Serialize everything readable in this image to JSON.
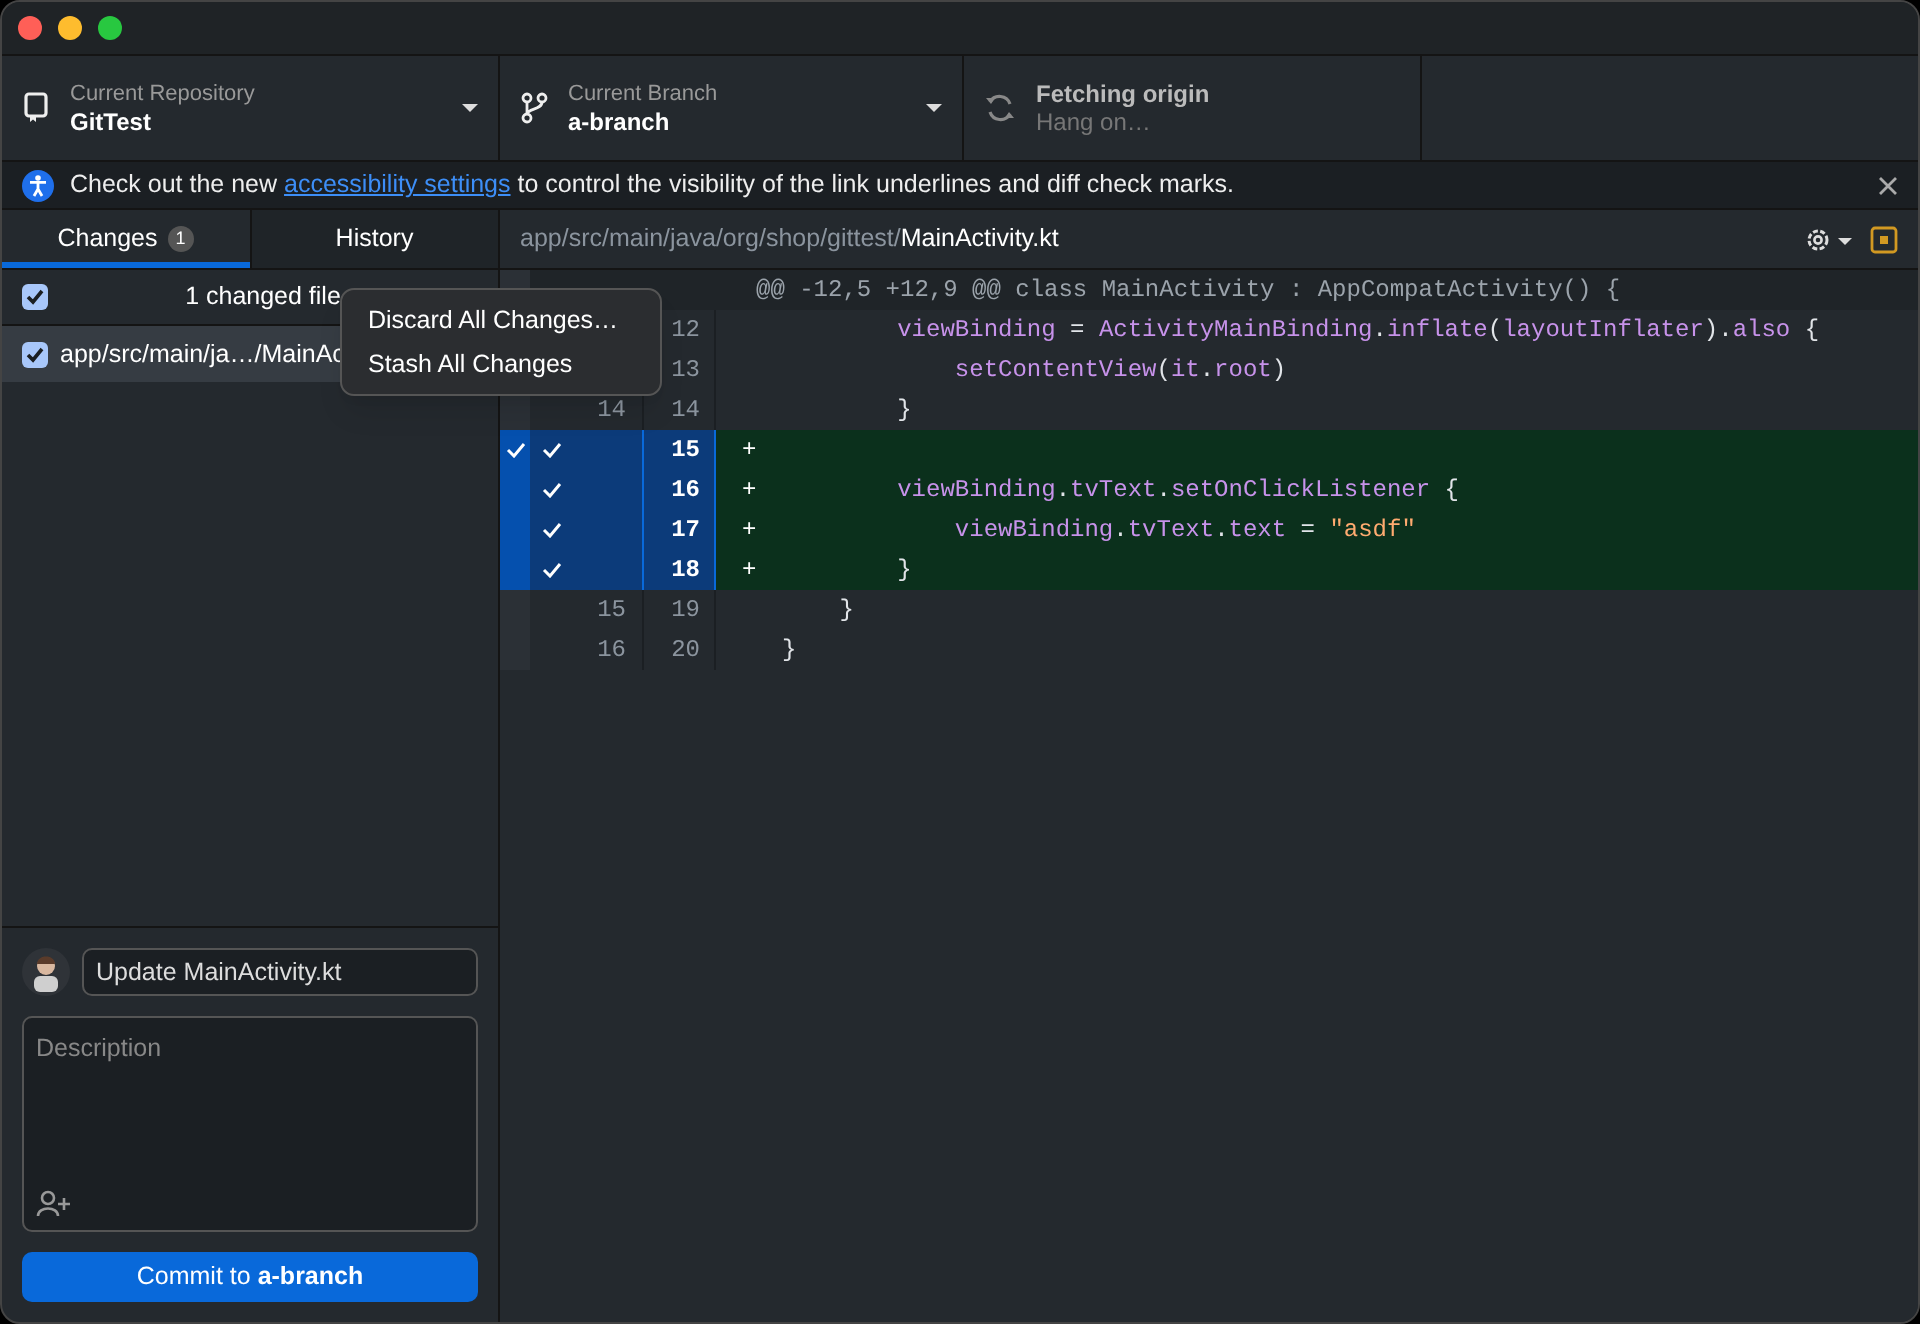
{
  "toolbar": {
    "repository": {
      "label": "Current Repository",
      "value": "GitTest"
    },
    "branch": {
      "label": "Current Branch",
      "value": "a-branch"
    },
    "fetch": {
      "label": "Fetching origin",
      "detail": "Hang on…"
    }
  },
  "banner": {
    "before": "Check out the new ",
    "link": "accessibility settings",
    "after": " to control the visibility of the link underlines and diff check marks."
  },
  "tabs": [
    {
      "label": "Changes",
      "count": "1",
      "selected": true
    },
    {
      "label": "History",
      "selected": false
    }
  ],
  "changes": {
    "all_checked": true,
    "summary": "1 changed file",
    "files": [
      {
        "path": "app/src/main/ja…/MainAc",
        "checked": true,
        "selected": true
      }
    ]
  },
  "context_menu": [
    "Discard All Changes…",
    "Stash All Changes"
  ],
  "commit": {
    "summary_value": "Update MainActivity.kt",
    "description_placeholder": "Description",
    "button_prefix": "Commit to ",
    "button_branch": "a-branch"
  },
  "diff": {
    "path_dir": "app/src/main/java/org/shop/gittest/",
    "path_file": "MainActivity.kt",
    "lines": [
      {
        "kind": "hunk",
        "text": "@@ -12,5 +12,9 @@ class MainActivity : AppCompatActivity() {"
      },
      {
        "kind": "context",
        "new": "12",
        "tokens": [
          {
            "kind": "ident",
            "text": "        viewBinding"
          },
          {
            "kind": "plain",
            "text": " = "
          },
          {
            "kind": "ident",
            "text": "ActivityMainBinding"
          },
          {
            "kind": "plain",
            "text": "."
          },
          {
            "kind": "ident",
            "text": "inflate"
          },
          {
            "kind": "plain",
            "text": "("
          },
          {
            "kind": "ident",
            "text": "layoutInflater"
          },
          {
            "kind": "plain",
            "text": ")."
          },
          {
            "kind": "ident",
            "text": "also"
          },
          {
            "kind": "plain",
            "text": " {"
          }
        ]
      },
      {
        "kind": "context",
        "new": "13",
        "tokens": [
          {
            "kind": "ident",
            "text": "            setContentView"
          },
          {
            "kind": "plain",
            "text": "("
          },
          {
            "kind": "ident",
            "text": "it"
          },
          {
            "kind": "plain",
            "text": "."
          },
          {
            "kind": "ident",
            "text": "root"
          },
          {
            "kind": "plain",
            "text": ")"
          }
        ]
      },
      {
        "kind": "context",
        "old": "14",
        "new": "14",
        "tokens": [
          {
            "kind": "plain",
            "text": "        }"
          }
        ]
      },
      {
        "kind": "add",
        "new": "15",
        "selected": true,
        "hunk_check": true,
        "marker": "+"
      },
      {
        "kind": "add",
        "new": "16",
        "selected": true,
        "marker": "+",
        "tokens": [
          {
            "kind": "ident",
            "text": "        viewBinding"
          },
          {
            "kind": "plain",
            "text": "."
          },
          {
            "kind": "ident",
            "text": "tvText"
          },
          {
            "kind": "plain",
            "text": "."
          },
          {
            "kind": "ident",
            "text": "setOnClickListener"
          },
          {
            "kind": "plain",
            "text": " {"
          }
        ]
      },
      {
        "kind": "add",
        "new": "17",
        "selected": true,
        "marker": "+",
        "tokens": [
          {
            "kind": "ident",
            "text": "            viewBinding"
          },
          {
            "kind": "plain",
            "text": "."
          },
          {
            "kind": "ident",
            "text": "tvText"
          },
          {
            "kind": "plain",
            "text": "."
          },
          {
            "kind": "ident",
            "text": "text"
          },
          {
            "kind": "plain",
            "text": " = "
          },
          {
            "kind": "string",
            "text": "\"asdf\""
          }
        ]
      },
      {
        "kind": "add",
        "new": "18",
        "selected": true,
        "marker": "+",
        "tokens": [
          {
            "kind": "plain",
            "text": "        }"
          }
        ]
      },
      {
        "kind": "context",
        "old": "15",
        "new": "19",
        "tokens": [
          {
            "kind": "plain",
            "text": "    }"
          }
        ]
      },
      {
        "kind": "context",
        "old": "16",
        "new": "20",
        "tokens": [
          {
            "kind": "plain",
            "text": "}"
          }
        ]
      }
    ]
  }
}
